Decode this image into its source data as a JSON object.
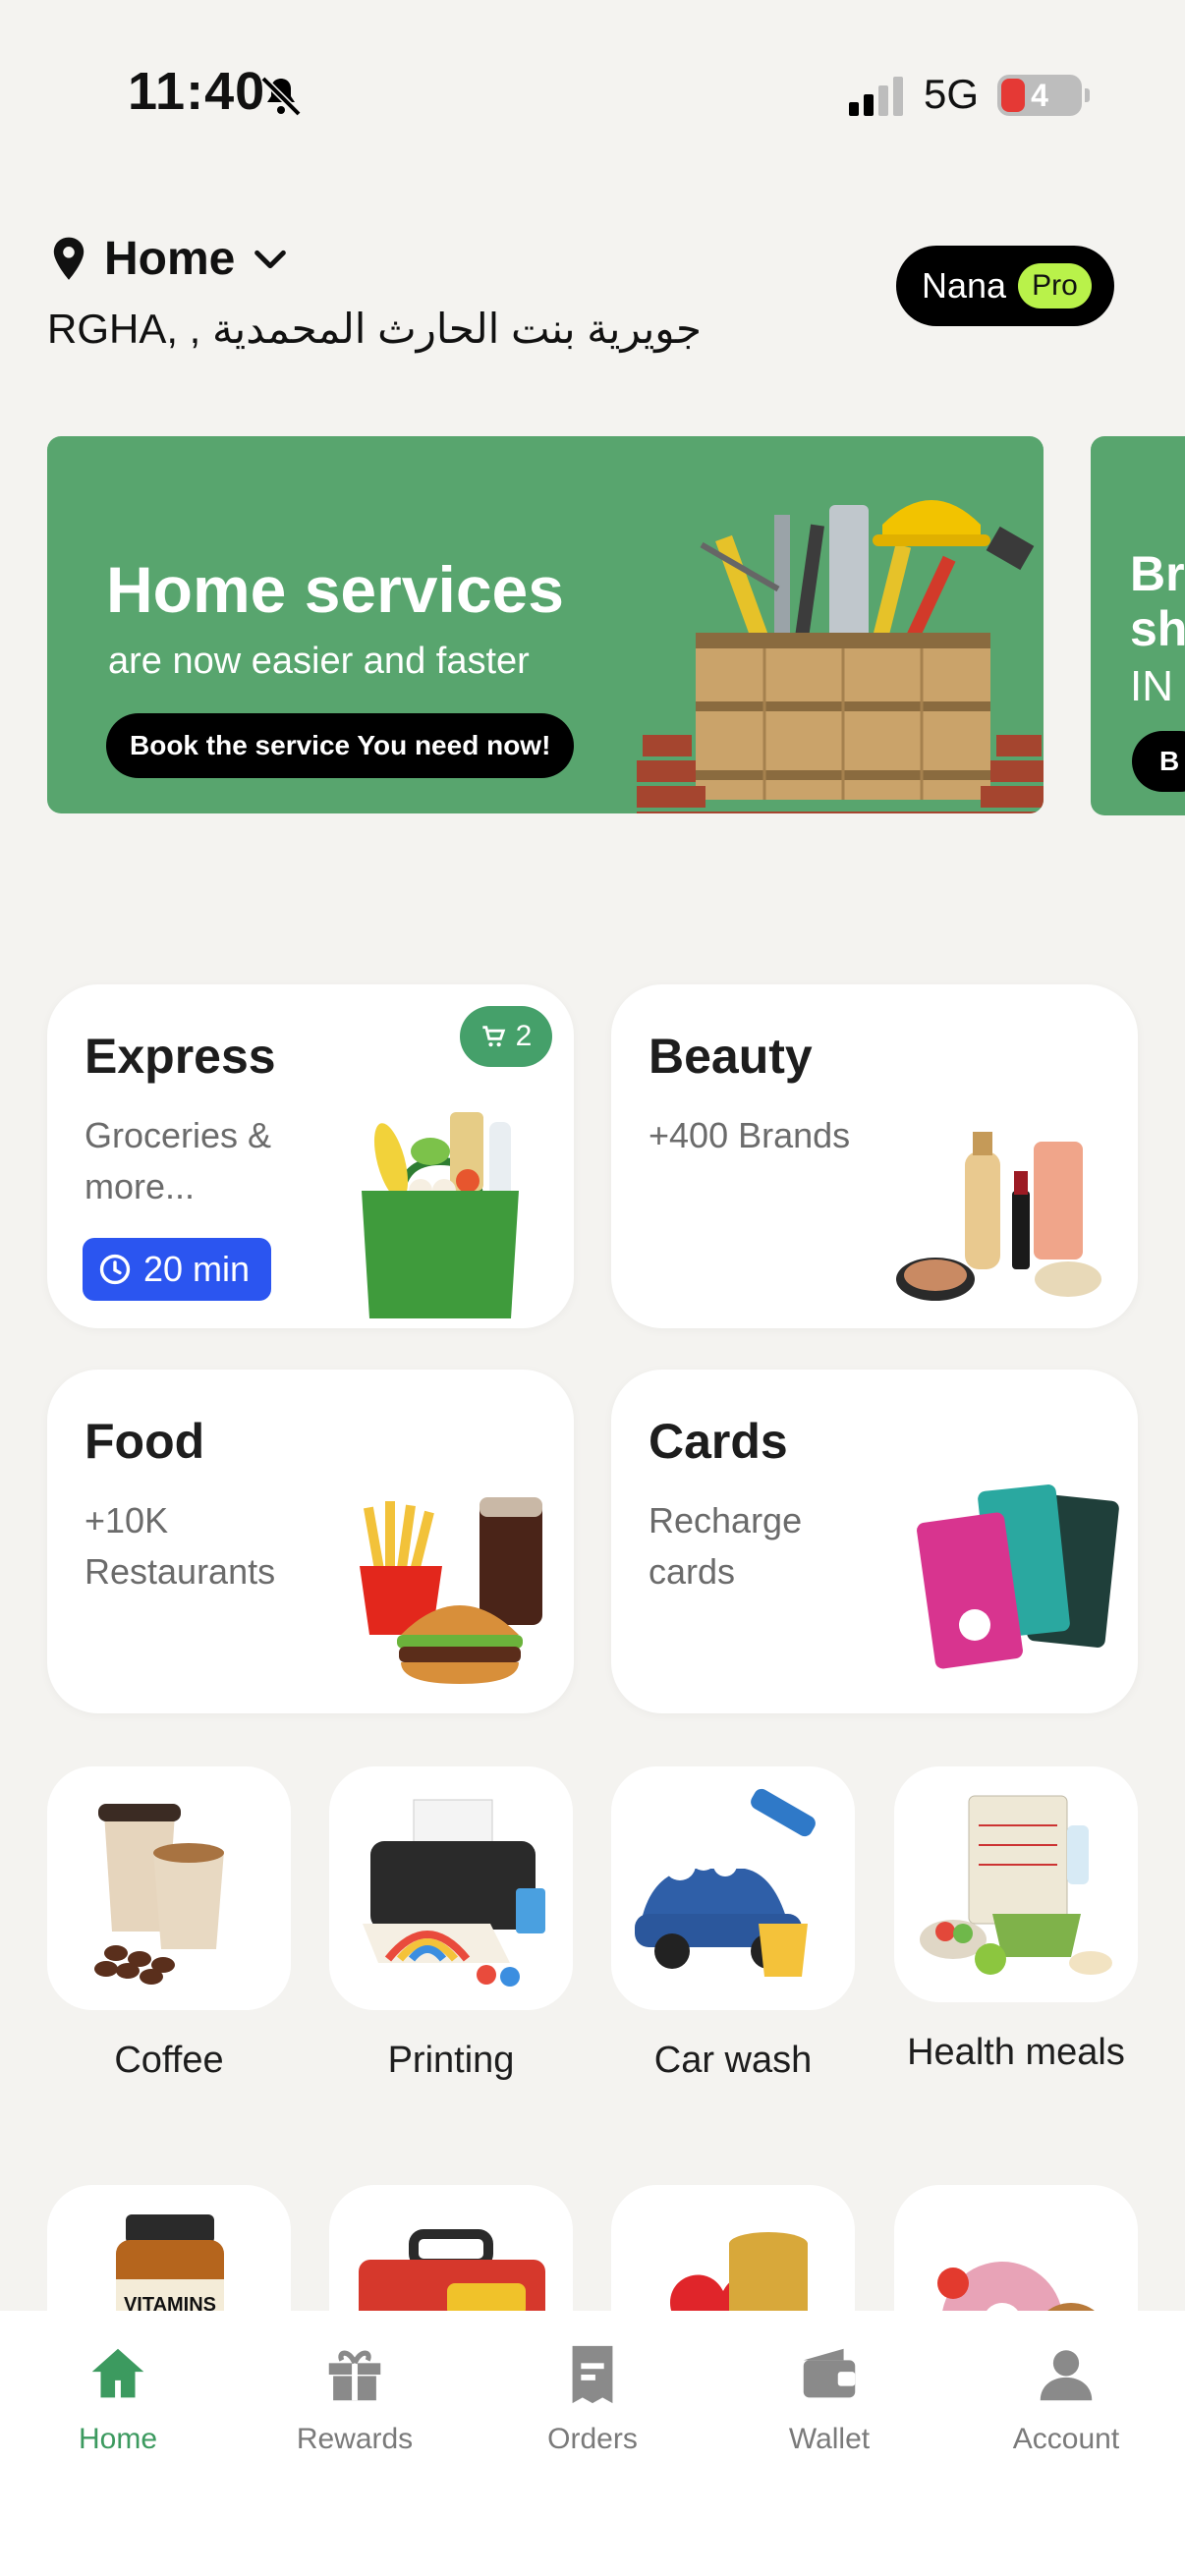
{
  "status_bar": {
    "time": "11:40",
    "network": "5G",
    "battery": "4"
  },
  "header": {
    "location_label": "Home",
    "address": "RGHA, , جويرية بنت الحارث المحمدية",
    "user_name": "Nana",
    "pro_badge": "Pro"
  },
  "banner": {
    "title": "Home services",
    "subtitle": "are now easier and faster",
    "button": "Book the service You need now!"
  },
  "banner_next": {
    "title_line1": "Br",
    "title_line2": "sh",
    "subtitle": "IN",
    "button": "B"
  },
  "services": [
    {
      "title": "Express",
      "subtitle": "Groceries & more...",
      "badge": "20 min",
      "cart_count": "2"
    },
    {
      "title": "Beauty",
      "subtitle": "+400 Brands"
    },
    {
      "title": "Food",
      "subtitle": "+10K Restaurants"
    },
    {
      "title": "Cards",
      "subtitle": "Recharge cards"
    }
  ],
  "tiles": [
    {
      "label": "Coffee"
    },
    {
      "label": "Printing"
    },
    {
      "label": "Car wash"
    },
    {
      "label": "Health meals"
    }
  ],
  "tiles_row2": [
    {
      "icon": "vitamins-icon",
      "text": "VITAMINS"
    },
    {
      "icon": "toolbox-icon"
    },
    {
      "icon": "heart-coins-icon"
    },
    {
      "icon": "sweets-icon"
    }
  ],
  "bottom_nav": [
    {
      "label": "Home",
      "icon": "home-icon",
      "active": true
    },
    {
      "label": "Rewards",
      "icon": "gift-icon"
    },
    {
      "label": "Orders",
      "icon": "receipt-icon"
    },
    {
      "label": "Wallet",
      "icon": "wallet-icon"
    },
    {
      "label": "Account",
      "icon": "person-icon"
    }
  ],
  "colors": {
    "accent": "#3c9a5f",
    "banner": "#58a56e",
    "time_badge": "#2b55f0",
    "pro": "#b9f24a"
  }
}
